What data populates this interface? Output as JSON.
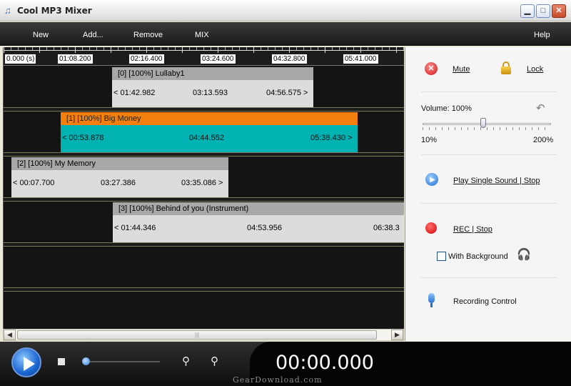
{
  "window": {
    "title": "Cool MP3 Mixer",
    "app_icon": "music-note-icon",
    "controls": [
      "minimize-icon",
      "maximize-icon",
      "close-icon"
    ]
  },
  "menu": {
    "new": "New",
    "add": "Add...",
    "remove": "Remove",
    "mix": "MIX",
    "help": "Help"
  },
  "ruler": {
    "labels": [
      "0.000 (s)",
      "01:08.200",
      "02:16.400",
      "03:24.600",
      "04:32.800",
      "05:41.000"
    ]
  },
  "tracks": [
    {
      "header": "[0] [100%] Lullaby1",
      "start": "< 01:42.982",
      "duration": "03:13.593",
      "end": "04:56.575 >"
    },
    {
      "header": "[1] [100%] Big Money",
      "start": "< 00:53.878",
      "duration": "04:44.552",
      "end": "05:38.430 >"
    },
    {
      "header": "[2] [100%] My Memory",
      "start": "< 00:07.700",
      "duration": "03:27.386",
      "end": "03:35.086 >"
    },
    {
      "header": "[3] [100%] Behind of you (Instrument)",
      "start": "< 01:44.346",
      "duration": "04:53.956",
      "end": "06:38.3"
    }
  ],
  "panel": {
    "mute": "Mute",
    "lock": "Lock",
    "volume_label": "Volume: 100%",
    "volume_percent": 100,
    "volume_min": "10%",
    "volume_max": "200%",
    "play_single": "Play Single Sound | Stop",
    "rec": "REC | Stop",
    "with_background": "With Background",
    "with_background_checked": false,
    "recording_control": "Recording Control"
  },
  "transport": {
    "time": "00:00.000",
    "watermark": "GearDownload.com"
  },
  "colors": {
    "active_clip_header": "#f47f0c",
    "active_clip_body": "#00b2b2",
    "clip_header": "#a8a8a8",
    "clip_body": "#dcdcdc"
  }
}
